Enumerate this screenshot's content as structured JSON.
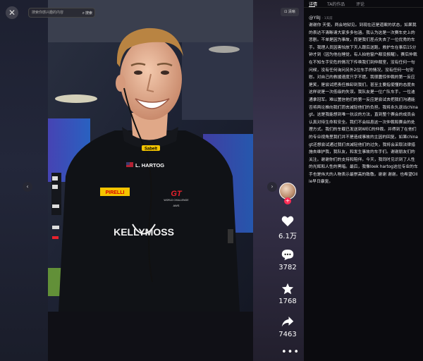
{
  "viewer": {
    "close_icon": "close-icon",
    "search": {
      "placeholder": "搜索你感兴趣的内容",
      "button_label": "搜索"
    },
    "more_label": "⊡ 清晰",
    "nav": {
      "left_icon": "chevron-left-icon",
      "right_icon": "chevron-right-icon"
    }
  },
  "actions": {
    "follow_icon": "plus-icon",
    "like_count": "6.1万",
    "comment_count": "3782",
    "favorite_count": "1768",
    "share_count": "7463",
    "more_icon": "ellipsis-icon"
  },
  "photo": {
    "cap_brand": "Sabelt",
    "name_tag": "L. HARTOG",
    "sponsor_left": "PIRELLI",
    "sponsor_right": "GT",
    "sponsor_right_sub": "WORLD CHALLENGE",
    "sponsor_right_sub2": "AWS",
    "team": "KELLYMOSS"
  },
  "panel": {
    "tabs": [
      "详情",
      "TA的作品",
      "评论"
    ],
    "active_tab": 0,
    "author": "@YBJ",
    "author_time": "· 1天前",
    "description": "谢谢你 天使。两会地狱见。到现在还是道案的状态，如果我的表达不清晰请大家多多包涵。我认为这是一次赛车史上的悲剧。不单是因为事故，而是我们差点失去了一位优秀的车手。我理人员因害怕放下天人跟后送跑，救护车在事后15分钟才到（因为他在睡觉，有人拍他窗户都没报醒）。赛后仲裁在不知车手安危的情况下传唤我们到仲裁室，没有任何一句问候，没有任何询问另外2位车手的情况，没有任何一句安慰。对自己的救援速度只字不提。我很震惊仲裁的第一反应是笑，是尝试把责任推卸到我们，甚至主要指使懂的态度去这样说是一次低级的失误。我队友是一位广队车手，一位迪通拿冠军。难以置信他们的第一反应是尝试去把我们沟通能否将两论推向我们而去减轻他们的负担。我将永久退出china gt。这是我能想到唯一抗议的方法，直到整个赛会的成员会认真对待生命和安全。我们不会姑息这一次仲裁和赛会的处理方式。我们的车载已发送到WEC的仲裁。并得到了在他们的专业视角里我们并不是造成事故的主因的回复。如果china gt还想尝试通过我们去减轻他们的过失，我将会采取法律措施去维护我，我队友，和发生事故的车手们。谢谢朋友们的关注。谢谢你们的支持和陪伴。今天，我同时见识到了人性的光辉和人性的黑暗。最后，我像loek hartog这位专业的车手也是伟大的人物表示最崇高的致敬。谢谢 谢谢。也希望Ollie早日康复。"
  },
  "colors": {
    "accent": "#fe2c55",
    "panel_bg": "#0b0b0f"
  }
}
